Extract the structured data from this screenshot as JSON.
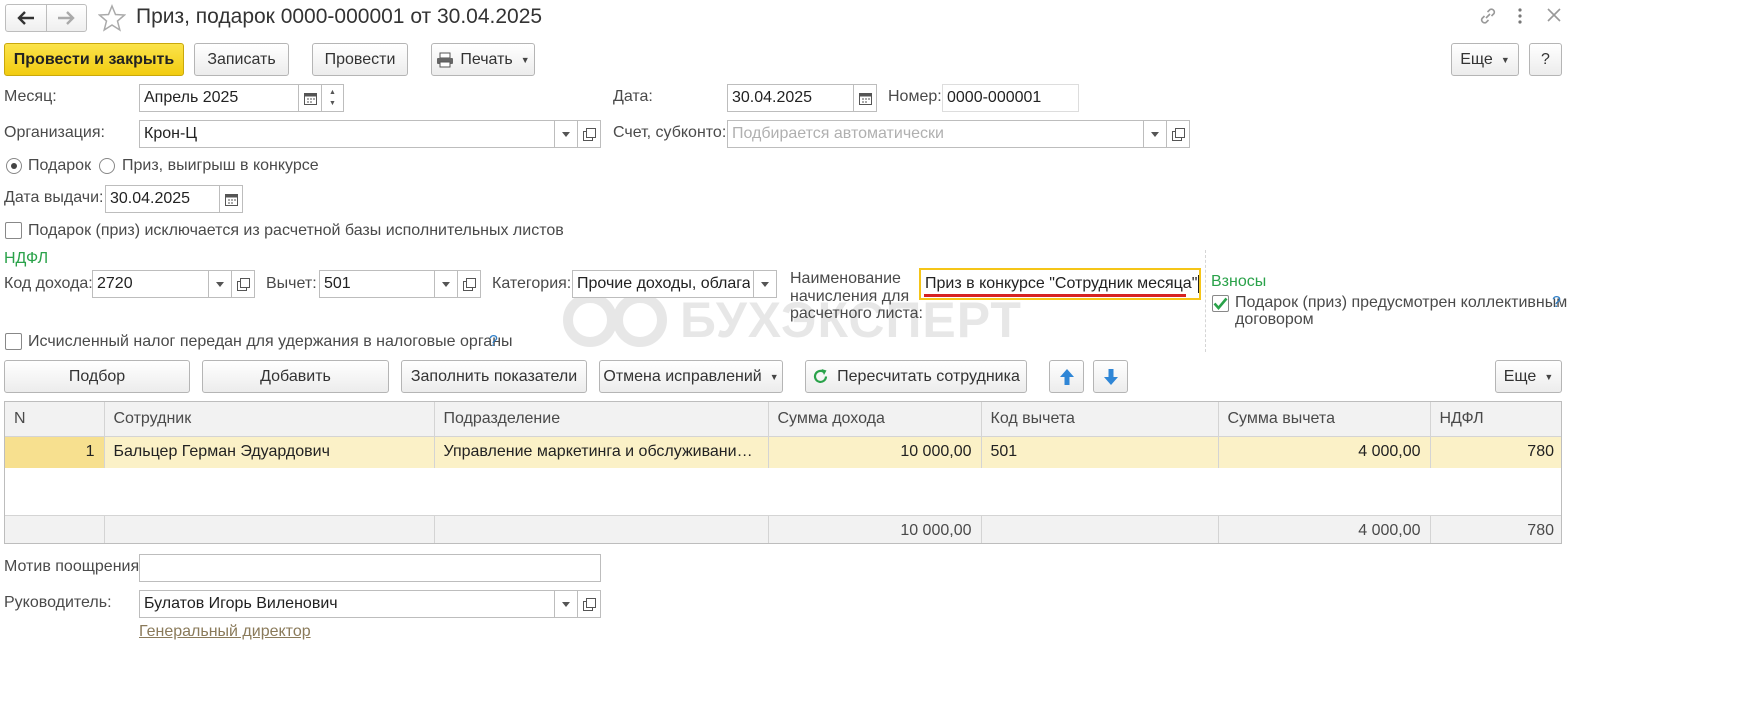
{
  "window": {
    "title": "Приз, подарок 0000-000001 от 30.04.2025"
  },
  "toolbar": {
    "post_close": "Провести и закрыть",
    "save": "Записать",
    "post": "Провести",
    "print": "Печать",
    "more": "Еще",
    "help": "?"
  },
  "form": {
    "month_label": "Месяц:",
    "month_value": "Апрель 2025",
    "date_label": "Дата:",
    "date_value": "30.04.2025",
    "number_label": "Номер:",
    "number_value": "0000-000001",
    "org_label": "Организация:",
    "org_value": "Крон-Ц",
    "account_label": "Счет, субконто:",
    "account_placeholder": "Подбирается автоматически",
    "radio_gift": "Подарок",
    "radio_prize": "Приз, выигрыш в конкурсе",
    "issue_date_label": "Дата выдачи:",
    "issue_date_value": "30.04.2025",
    "exclude_checkbox": "Подарок (приз) исключается из расчетной базы исполнительных листов",
    "ndfl_header": "НДФЛ",
    "income_code_label": "Код дохода:",
    "income_code_value": "2720",
    "deduction_label": "Вычет:",
    "deduction_value": "501",
    "category_label": "Категория:",
    "category_value": "Прочие доходы, облагаемые",
    "accrual_name_label_1": "Наименование",
    "accrual_name_label_2": "начисления для",
    "accrual_name_label_3": "расчетного листа:",
    "accrual_name_value": "Приз в конкурсе \"Сотрудник месяца\"",
    "contributions_header": "Взносы",
    "collective_checkbox_1": "Подарок (приз) предусмотрен коллективным",
    "collective_checkbox_2": "договором",
    "help_mark": "?",
    "tax_transferred_checkbox": "Исчисленный налог передан для удержания в налоговые органы",
    "motive_label": "Мотив поощрения:",
    "motive_value": "",
    "head_label": "Руководитель:",
    "head_value": "Булатов Игорь Виленович",
    "head_position": "Генеральный директор"
  },
  "table_toolbar": {
    "pick": "Подбор",
    "add": "Добавить",
    "fill": "Заполнить показатели",
    "cancel_fixes": "Отмена исправлений",
    "recalc": "Пересчитать сотрудника",
    "more": "Еще"
  },
  "table": {
    "columns": [
      "N",
      "Сотрудник",
      "Подразделение",
      "Сумма дохода",
      "Код вычета",
      "Сумма вычета",
      "НДФЛ"
    ],
    "rows": [
      [
        "1",
        "Бальцер Герман Эдуардович",
        "Управление маркетинга и обслуживания клиентов",
        "10 000,00",
        "501",
        "4 000,00",
        "780"
      ]
    ],
    "totals": [
      "",
      "",
      "",
      "10 000,00",
      "",
      "4 000,00",
      "780"
    ]
  },
  "watermark": "БУХЭКСПЕРТ",
  "colors": {
    "accent_yellow": "#f5d21f",
    "green": "#2aa24a",
    "link": "#8a7a5a",
    "row_selected": "#fbf1c7"
  }
}
